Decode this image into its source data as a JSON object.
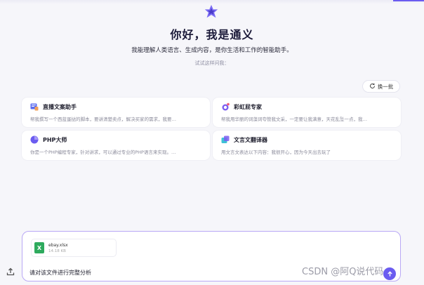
{
  "header": {
    "title": "你好，我是通义",
    "subtitle": "我能理解人类语言、生成内容，是你生活和工作的智能助手。",
    "try_label": "试试这样问我："
  },
  "refresh": {
    "label": "换一批",
    "icon": "refresh-icon"
  },
  "cards": [
    {
      "title": "直播文案助手",
      "desc": "帮我撰写一个西蓝蛋挞的脚本，要讲清楚卖点，解决买家的需求，我要…",
      "icon": "live-script-icon"
    },
    {
      "title": "彩虹屁专家",
      "desc": "帮我用华丽的词藻词夸赞我文采，一定要让我满意，天花乱坠一点，我…",
      "icon": "rainbow-icon"
    },
    {
      "title": "PHP大师",
      "desc": "你是一个PHP编程专家，针对讲求，可以通过专业的PHP语言来实现。…",
      "icon": "php-icon"
    },
    {
      "title": "文言文翻译器",
      "desc": "用文言文表达以下内容：我很开心，因为今天出去玩了",
      "icon": "translate-icon"
    }
  ],
  "input": {
    "file": {
      "name": "ebay.xlsx",
      "size": "14.18 KB",
      "icon_letter": "X"
    },
    "text": "请对该文件进行完整分析"
  },
  "watermark": "CSDN @阿Q说代码",
  "colors": {
    "accent": "#6b5cf0",
    "excel": "#2eaa5d",
    "background": "#f6f6fa"
  }
}
